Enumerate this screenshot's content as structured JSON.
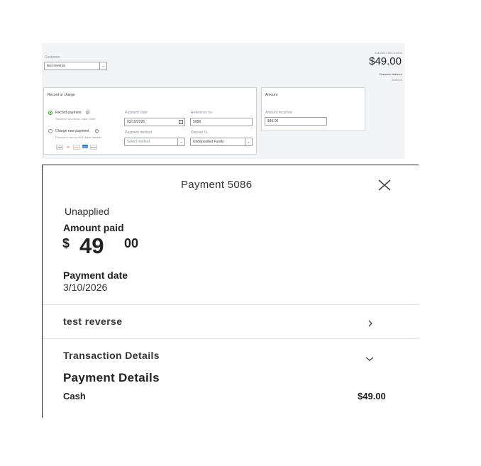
{
  "form": {
    "customer_label": "Customer",
    "customer_value": "test reverse",
    "amount_received_label": "AMOUNT RECEIVED",
    "amount_received_value": "$49.00",
    "customer_balance_label": "Customer balance",
    "customer_balance_value": "-$786.00",
    "record_charge": {
      "title": "Record or charge",
      "record_payment_label": "Record payment",
      "record_payment_sub": "Received via check, cash, other",
      "charge_payment_label": "Charge new payment",
      "charge_payment_sub": "Process a card or ACH bank transfer",
      "payment_date_label": "Payment Date",
      "payment_date_value": "03/10/2026",
      "reference_no_label": "Reference no.",
      "reference_no_value": "5086",
      "payment_method_label": "Payment method",
      "payment_method_placeholder": "Select method",
      "deposit_to_label": "Deposit To",
      "deposit_to_value": "Undeposited Funds",
      "card_logos": [
        "VISA",
        "MC",
        "DISC",
        "AMEX",
        "BANK"
      ]
    },
    "amount_card": {
      "title": "Amount",
      "amount_received_label": "Amount received",
      "amount_received_value": "$49.00"
    },
    "colors": {
      "accent": "#2ca01c",
      "panel_bg": "#f3f4f6"
    }
  },
  "detail": {
    "title": "Payment 5086",
    "status": "Unapplied",
    "amount_paid_label": "Amount paid",
    "currency_symbol": "$",
    "amount_whole": "49",
    "amount_cents": "00",
    "payment_date_label": "Payment date",
    "payment_date_value": "3/10/2026",
    "customer_name": "test reverse",
    "transaction_details_label": "Transaction Details",
    "payment_details_label": "Payment Details",
    "method_label": "Cash",
    "method_amount": "$49.00",
    "icons": [
      "close-icon",
      "chevron-right-icon",
      "chevron-down-icon"
    ]
  }
}
